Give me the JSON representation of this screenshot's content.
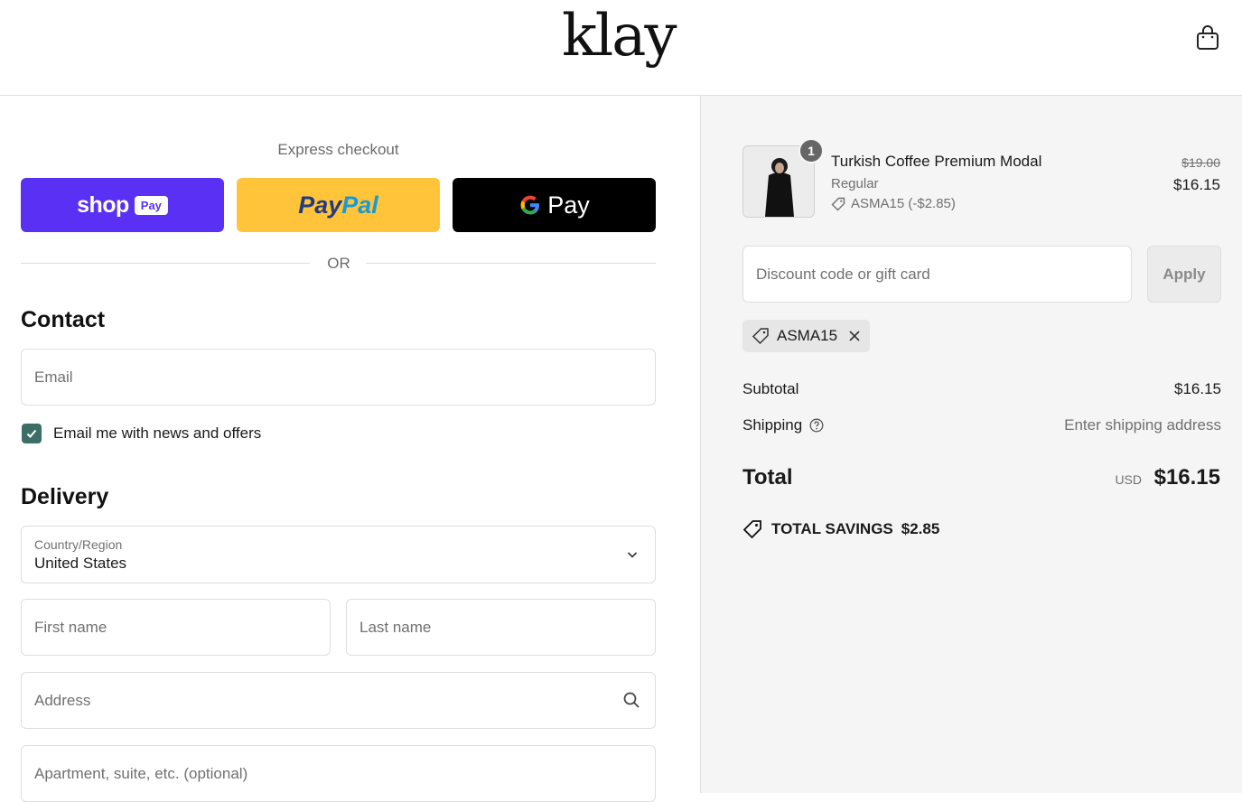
{
  "header": {
    "logo": "klay",
    "cart_icon": "shopping-bag-icon"
  },
  "express": {
    "label": "Express checkout",
    "shop_pay": {
      "word": "shop",
      "badge": "Pay"
    },
    "paypal": {
      "part1": "Pay",
      "part2": "Pal"
    },
    "gpay": {
      "word": "Pay"
    },
    "or": "OR"
  },
  "contact": {
    "title": "Contact",
    "email_placeholder": "Email",
    "newsletter_label": "Email me with news and offers",
    "newsletter_checked": true
  },
  "delivery": {
    "title": "Delivery",
    "country_label": "Country/Region",
    "country_value": "United States",
    "first_name_placeholder": "First name",
    "last_name_placeholder": "Last name",
    "address_placeholder": "Address",
    "apartment_placeholder": "Apartment, suite, etc. (optional)"
  },
  "order": {
    "item": {
      "quantity": "1",
      "name": "Turkish Coffee Premium Modal",
      "variant": "Regular",
      "discount": "ASMA15 (-$2.85)",
      "price_original": "$19.00",
      "price": "$16.15"
    },
    "discount_placeholder": "Discount code or gift card",
    "apply_label": "Apply",
    "applied_code": "ASMA15",
    "subtotal_label": "Subtotal",
    "subtotal_value": "$16.15",
    "shipping_label": "Shipping",
    "shipping_value": "Enter shipping address",
    "total_label": "Total",
    "total_currency": "USD",
    "total_value": "$16.15",
    "savings_label": "TOTAL SAVINGS",
    "savings_value": "$2.85"
  },
  "colors": {
    "shop_pay": "#5a31f4",
    "paypal": "#ffc439",
    "gpay": "#000000",
    "checkbox": "#3b6e66",
    "summary_bg": "#f5f5f5"
  }
}
